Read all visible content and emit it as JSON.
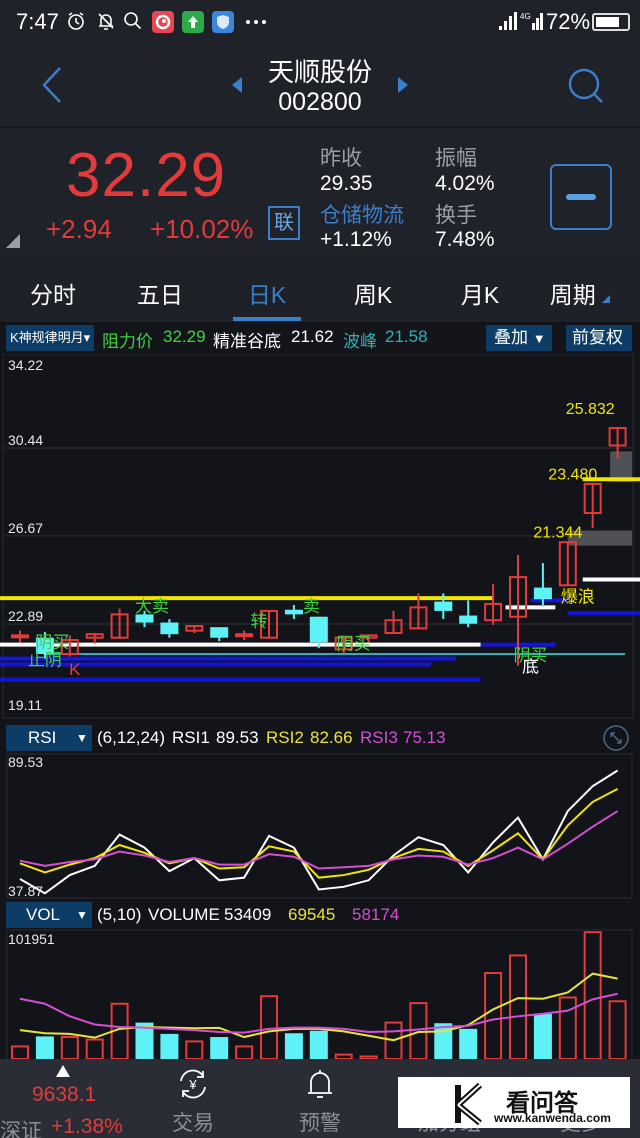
{
  "status_bar": {
    "time": "7:47",
    "icons": [
      "alarm-icon",
      "bell-off-icon",
      "search-icon",
      "app-red-icon",
      "app-green-upload-icon",
      "app-blue-shield-icon",
      "more-icon"
    ],
    "signal": "signal-icon",
    "network": "4G",
    "battery_percent": "72%",
    "battery_level": 0.72
  },
  "header": {
    "stock_name": "天顺股份",
    "stock_code": "002800",
    "back_icon": "chevron-left-icon",
    "prev_icon": "triangle-left-icon",
    "next_icon": "triangle-right-icon",
    "search_icon": "search-icon"
  },
  "quote": {
    "price": "32.29",
    "change": "+2.94",
    "change_pct": "+10.02%",
    "lian_label": "联",
    "prev_close_label": "昨收",
    "prev_close": "29.35",
    "amplitude_label": "振幅",
    "amplitude": "4.02%",
    "sector_label": "仓储物流",
    "sector_change": "+1.12%",
    "turnover_label": "换手",
    "turnover": "7.48%",
    "colors": {
      "up": "#e33b3b",
      "accent": "#3a7fc8"
    }
  },
  "tabs": [
    {
      "label": "分时",
      "active": false
    },
    {
      "label": "五日",
      "active": false
    },
    {
      "label": "日K",
      "active": true
    },
    {
      "label": "周K",
      "active": false
    },
    {
      "label": "月K",
      "active": false
    },
    {
      "label": "周期",
      "active": false
    }
  ],
  "indicator_bar": {
    "indicator_select": "K神规律明月",
    "resistance_label": "阻力价",
    "resistance_value": "32.29",
    "valley_label": "精准谷底",
    "valley_value": "21.62",
    "peak_label": "波峰",
    "peak_value": "21.58",
    "overlay_button": "叠加",
    "adjust_button": "前复权"
  },
  "rsi_bar": {
    "select": "RSI",
    "params": "(6,12,24)",
    "rsi1_label": "RSI1",
    "rsi1_value": "89.53",
    "rsi2_label": "RSI2",
    "rsi2_value": "82.66",
    "rsi3_label": "RSI3",
    "rsi3_value": "75.13"
  },
  "vol_bar": {
    "select": "VOL",
    "params": "(5,10)",
    "volume_label": "VOLUME",
    "volume_value": "53409",
    "ma5_value": "69545",
    "ma10_value": "58174"
  },
  "chart_data": [
    {
      "type": "candlestick",
      "title": "日K",
      "ylim": [
        19.11,
        34.22
      ],
      "y_ticks": [
        "34.22",
        "30.44",
        "26.67",
        "22.89",
        "19.11"
      ],
      "candles": [
        {
          "o": 22.35,
          "c": 22.4,
          "h": 22.6,
          "l": 22.1
        },
        {
          "o": 22.3,
          "c": 21.6,
          "h": 22.55,
          "l": 21.4
        },
        {
          "o": 21.6,
          "c": 22.2,
          "h": 22.4,
          "l": 21.5
        },
        {
          "o": 22.3,
          "c": 22.45,
          "h": 22.5,
          "l": 22.05
        },
        {
          "o": 22.3,
          "c": 23.3,
          "h": 23.55,
          "l": 22.25
        },
        {
          "o": 23.3,
          "c": 22.95,
          "h": 23.45,
          "l": 22.75
        },
        {
          "o": 22.95,
          "c": 22.45,
          "h": 23.1,
          "l": 22.3
        },
        {
          "o": 22.6,
          "c": 22.8,
          "h": 22.8,
          "l": 22.5
        },
        {
          "o": 22.75,
          "c": 22.3,
          "h": 22.75,
          "l": 22.15
        },
        {
          "o": 22.4,
          "c": 22.45,
          "h": 22.6,
          "l": 22.2
        },
        {
          "o": 22.3,
          "c": 23.45,
          "h": 23.45,
          "l": 22.3
        },
        {
          "o": 23.5,
          "c": 23.3,
          "h": 23.7,
          "l": 23.1
        },
        {
          "o": 23.2,
          "c": 22.1,
          "h": 23.2,
          "l": 21.85
        },
        {
          "o": 21.8,
          "c": 22.3,
          "h": 22.4,
          "l": 21.65
        },
        {
          "o": 22.3,
          "c": 22.4,
          "h": 22.45,
          "l": 22.1
        },
        {
          "o": 22.5,
          "c": 23.05,
          "h": 23.45,
          "l": 22.5
        },
        {
          "o": 22.7,
          "c": 23.6,
          "h": 24.2,
          "l": 22.7
        },
        {
          "o": 23.85,
          "c": 23.45,
          "h": 24.2,
          "l": 23.1
        },
        {
          "o": 23.25,
          "c": 22.9,
          "h": 23.9,
          "l": 22.75
        },
        {
          "o": 23.05,
          "c": 23.75,
          "h": 24.6,
          "l": 22.85
        },
        {
          "o": 23.2,
          "c": 24.9,
          "h": 25.85,
          "l": 21.1
        },
        {
          "o": 24.45,
          "c": 23.95,
          "h": 25.5,
          "l": 23.7
        },
        {
          "o": 24.55,
          "c": 26.4,
          "h": 26.4,
          "l": 24.55
        },
        {
          "o": 27.65,
          "c": 28.9,
          "h": 28.9,
          "l": 27.0
        },
        {
          "o": 30.55,
          "c": 31.3,
          "h": 31.3,
          "l": 30.0
        }
      ],
      "lines": [
        {
          "name": "resistance-yellow",
          "color": "#f2e600",
          "y": 24.0,
          "from": 0,
          "to": 19
        },
        {
          "name": "resistance-yellow-2",
          "color": "#f2e600",
          "y": 29.1,
          "from": 22.6,
          "to": 25
        },
        {
          "name": "white-line-1",
          "color": "#ffffff",
          "y": 22.0,
          "from": 0,
          "to": 18.5
        },
        {
          "name": "white-line-2",
          "color": "#ffffff",
          "y": 23.6,
          "from": 19.5,
          "to": 21.5
        },
        {
          "name": "white-line-3",
          "color": "#ffffff",
          "y": 24.8,
          "from": 22.6,
          "to": 25
        },
        {
          "name": "blue-line-1",
          "color": "#1515d6",
          "y": 21.4,
          "from": 0,
          "to": 17.5
        },
        {
          "name": "blue-line-2",
          "color": "#1515d6",
          "y": 21.15,
          "from": 0,
          "to": 16.5
        },
        {
          "name": "blue-line-3",
          "color": "#1515d6",
          "y": 20.5,
          "from": 0,
          "to": 18.5
        },
        {
          "name": "blue-line-4",
          "color": "#1515d6",
          "y": 22.0,
          "from": 18.5,
          "to": 21.5
        },
        {
          "name": "blue-line-5",
          "color": "#1515d6",
          "y": 23.9,
          "from": 20.5,
          "to": 22
        },
        {
          "name": "blue-line-6",
          "color": "#1515d6",
          "y": 23.35,
          "from": 22,
          "to": 25
        },
        {
          "name": "teal-line",
          "color": "#2fb0b5",
          "y": 21.6,
          "from": 1,
          "to": 24.3
        }
      ],
      "annotations": [
        {
          "text": "大卖",
          "idx": 5.3,
          "price": 23.4,
          "color": "#3fd23f"
        },
        {
          "text": "转",
          "idx": 9.6,
          "price": 22.75,
          "color": "#3fd23f"
        },
        {
          "text": "卖",
          "idx": 11.7,
          "price": 23.4,
          "color": "#3fd23f"
        },
        {
          "text": "阴买",
          "idx": 1.3,
          "price": 21.85,
          "color": "#3fd23f"
        },
        {
          "text": "止阴",
          "idx": 1.0,
          "price": 21.1,
          "color": "#3fd23f"
        },
        {
          "text": "K",
          "idx": 2.2,
          "price": 20.7,
          "color": "#e33b3b"
        },
        {
          "text": "阴买",
          "idx": 13.4,
          "price": 21.8,
          "color": "#3fd23f"
        },
        {
          "text": "阴买",
          "idx": 20.5,
          "price": 21.3,
          "color": "#3fd23f"
        },
        {
          "text": "底",
          "idx": 20.5,
          "price": 20.8,
          "color": "#ffffff"
        },
        {
          "text": "爆浪",
          "idx": 22.4,
          "price": 23.8,
          "color": "#f2e600"
        },
        {
          "text": "21.344",
          "idx": 21.6,
          "price": 26.6,
          "color": "#f2e600"
        },
        {
          "text": "23.480",
          "idx": 22.2,
          "price": 29.1,
          "color": "#f2e600"
        },
        {
          "text": "25.832",
          "idx": 22.9,
          "price": 31.9,
          "color": "#f2e600"
        }
      ],
      "gray_boxes": [
        {
          "from": 22.0,
          "to": 25,
          "low": 26.25,
          "high": 26.9
        },
        {
          "from": 23.7,
          "to": 25,
          "low": 29.0,
          "high": 30.3
        }
      ]
    },
    {
      "type": "line",
      "title": "RSI",
      "ylim": [
        37.87,
        89.53
      ],
      "y_ticks": [
        "89.53",
        "37.87"
      ],
      "series": [
        {
          "name": "RSI1",
          "color": "#ffffff",
          "values": [
            44,
            38.5,
            45.5,
            49,
            61,
            56,
            47,
            52,
            43.5,
            44.5,
            60.5,
            56,
            40,
            41,
            43.5,
            53,
            60,
            57,
            46.5,
            58,
            67.5,
            51.5,
            70,
            79.5,
            85.5
          ]
        },
        {
          "name": "RSI2",
          "color": "#f2e600",
          "values": [
            50,
            46.5,
            49.5,
            52,
            57,
            54,
            50,
            52,
            48,
            48.5,
            56.5,
            54.5,
            44.5,
            45.5,
            47.5,
            52,
            55.5,
            54.5,
            49,
            55,
            61.5,
            51.5,
            64.5,
            73.5,
            78.5
          ]
        },
        {
          "name": "RSI3",
          "color": "#d34fd3",
          "values": [
            51,
            49,
            50.5,
            51.5,
            54.5,
            53,
            50.5,
            52,
            49.5,
            49.5,
            53.5,
            52.5,
            48,
            48.5,
            49,
            51.5,
            53,
            52.5,
            49.5,
            52,
            56,
            51.5,
            57.5,
            64,
            70
          ]
        }
      ]
    },
    {
      "type": "bar",
      "title": "VOL",
      "ylim": [
        0,
        101951
      ],
      "y_ticks": [
        "101951"
      ],
      "volumes": [
        10000,
        18000,
        17500,
        15500,
        44000,
        29000,
        20000,
        14000,
        17500,
        10000,
        50000,
        20500,
        22500,
        3500,
        2000,
        29000,
        44500,
        28500,
        24000,
        68500,
        82500,
        36000,
        49000,
        101000,
        46000
      ],
      "up": [
        true,
        false,
        true,
        true,
        true,
        false,
        false,
        true,
        false,
        true,
        true,
        false,
        false,
        true,
        true,
        true,
        true,
        false,
        false,
        true,
        true,
        false,
        true,
        true,
        true
      ],
      "ma5": [
        23000,
        20500,
        20000,
        17000,
        24000,
        25500,
        25000,
        24500,
        24800,
        17500,
        22000,
        24000,
        24000,
        22000,
        18500,
        15000,
        21500,
        22000,
        27000,
        39500,
        48500,
        48000,
        53000,
        68000,
        64000
      ],
      "ma10": [
        48000,
        44000,
        34000,
        27500,
        25500,
        25000,
        24000,
        23000,
        21500,
        21000,
        24000,
        25000,
        25000,
        24000,
        21500,
        22000,
        23500,
        25500,
        26500,
        31500,
        34000,
        36000,
        38500,
        47500,
        52000
      ]
    }
  ],
  "bottom_nav": {
    "index_arrow": "triangle-up-icon",
    "index_value": "9638.1",
    "index_name": "深证",
    "index_change": "+1.38%",
    "items": [
      {
        "icon": "yuan-exchange-icon",
        "label": "交易"
      },
      {
        "icon": "bell-icon",
        "label": "预警"
      },
      {
        "icon": "add-group-icon",
        "label": "加分组"
      },
      {
        "icon": "more-circle-icon",
        "label": "更多"
      }
    ]
  },
  "watermark": {
    "brand": "看问答",
    "url": "www.kanwenda.com"
  }
}
